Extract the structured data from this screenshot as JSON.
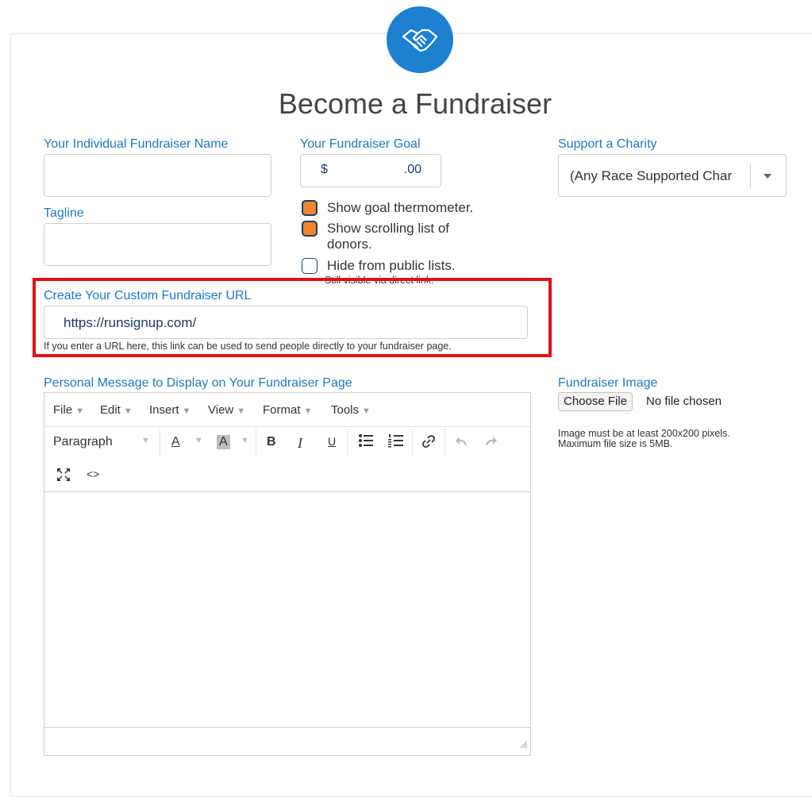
{
  "page": {
    "title": "Become a Fundraiser"
  },
  "fields": {
    "name_label": "Your Individual Fundraiser Name",
    "name_value": "",
    "tagline_label": "Tagline",
    "tagline_value": "",
    "goal_label": "Your Fundraiser Goal",
    "goal_currency": "$",
    "goal_cents": ".00",
    "charity_label": "Support a Charity",
    "charity_value": "(Any Race Supported Char"
  },
  "options": [
    {
      "label": "Show goal thermometer.",
      "checked": true
    },
    {
      "label": "Show scrolling list of donors.",
      "checked": true
    },
    {
      "label": "Hide from public lists.",
      "checked": false,
      "note": "Still visible via direct link."
    }
  ],
  "url": {
    "label": "Create Your Custom Fundraiser URL",
    "prefix": "https://runsignup.com/",
    "help": "If you enter a URL here, this link can be used to send people directly to your fundraiser page."
  },
  "message": {
    "label": "Personal Message to Display on Your Fundraiser Page",
    "menus": [
      "File",
      "Edit",
      "Insert",
      "View",
      "Format",
      "Tools"
    ],
    "block_format": "Paragraph",
    "text_color_glyph": "A",
    "bg_color_glyph": "A",
    "bold_glyph": "B",
    "italic_glyph": "I",
    "underline_glyph": "U",
    "code_glyph": "<>"
  },
  "image": {
    "label": "Fundraiser Image",
    "button": "Choose File",
    "status": "No file chosen",
    "help_line1": "Image must be at least 200x200 pixels.",
    "help_line2": "Maximum file size is 5MB."
  },
  "colors": {
    "accent": "#1e78c2",
    "logo_bg": "#1d80d1",
    "checkbox_checked": "#f0882b",
    "highlight": "#e10f14"
  }
}
